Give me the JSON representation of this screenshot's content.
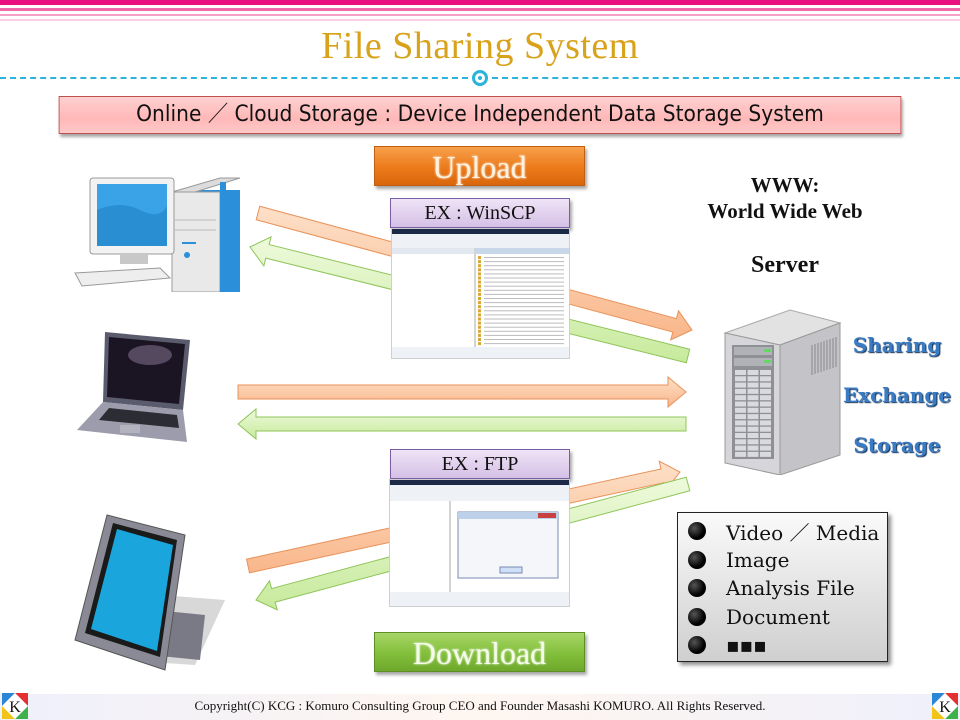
{
  "header": {
    "title": "File Sharing System",
    "subtitle": "Online ／ Cloud Storage : Device Independent Data Storage System"
  },
  "flow": {
    "upload_label": "Upload",
    "download_label": "Download",
    "example_upload": "EX : WinSCP",
    "example_download": "EX : FTP"
  },
  "clients": [
    {
      "name": "Desktop PC",
      "icon": "desktop-computer-icon"
    },
    {
      "name": "Laptop",
      "icon": "laptop-icon"
    },
    {
      "name": "Tablet",
      "icon": "tablet-icon"
    }
  ],
  "server": {
    "www_line1": "WWW:",
    "www_line2": "World Wide Web",
    "label": "Server",
    "icon": "server-tower-icon",
    "roles": [
      "Sharing",
      "Exchange",
      "Storage"
    ]
  },
  "file_types": [
    "Video ／ Media",
    "Image",
    "Analysis File",
    "Document",
    "▪▪▪"
  ],
  "footer": {
    "copyright": "Copyright(C)  KCG : Komuro Consulting Group   CEO and Founder   Masashi KOMURO. All Rights Reserved.",
    "logo_letter": "K"
  },
  "colors": {
    "title": "#d9a21b",
    "stripe": "#e8117f",
    "dash": "#2bb3dc",
    "upload_arrow": "#fbc7a0",
    "download_arrow": "#d4f0b0",
    "role_text": "#3a7cc4"
  }
}
